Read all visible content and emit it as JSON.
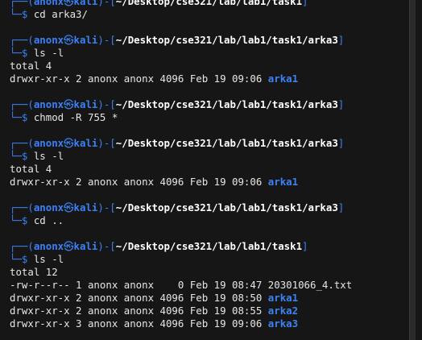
{
  "terminal": {
    "prompt": {
      "user": "anonx",
      "skull": "㉿",
      "host": "kali",
      "dollar": "$"
    },
    "colors": {
      "background": "#161616",
      "accent_blue": "#3b82f6",
      "text": "#e6e6e6",
      "path_text": "#ffffff"
    },
    "blocks": [
      {
        "prompt_path": "~/Desktop/cse321/lab/lab1/task1",
        "command": "cd arka3/"
      },
      {
        "prompt_path": "~/Desktop/cse321/lab/lab1/task1/arka3",
        "command": "ls -l",
        "output": [
          "total 4",
          {
            "perm": "drwxr-xr-x 2 anonx anonx 4096 Feb 19 09:06 ",
            "name": "arka1",
            "dir": true
          }
        ]
      },
      {
        "prompt_path": "~/Desktop/cse321/lab/lab1/task1/arka3",
        "command": "chmod -R 755 *"
      },
      {
        "prompt_path": "~/Desktop/cse321/lab/lab1/task1/arka3",
        "command": "ls -l",
        "output": [
          "total 4",
          {
            "perm": "drwxr-xr-x 2 anonx anonx 4096 Feb 19 09:06 ",
            "name": "arka1",
            "dir": true
          }
        ]
      },
      {
        "prompt_path": "~/Desktop/cse321/lab/lab1/task1/arka3",
        "command": "cd .."
      },
      {
        "prompt_path": "~/Desktop/cse321/lab/lab1/task1",
        "command": "ls -l",
        "output": [
          "total 12",
          {
            "perm": "-rw-r--r-- 1 anonx anonx    0 Feb 19 08:47 ",
            "name": "20301066_4.txt",
            "dir": false
          },
          {
            "perm": "drwxr-xr-x 2 anonx anonx 4096 Feb 19 08:50 ",
            "name": "arka1",
            "dir": true
          },
          {
            "perm": "drwxr-xr-x 2 anonx anonx 4096 Feb 19 08:55 ",
            "name": "arka2",
            "dir": true
          },
          {
            "perm": "drwxr-xr-x 3 anonx anonx 4096 Feb 19 09:06 ",
            "name": "arka3",
            "dir": true
          }
        ]
      }
    ]
  }
}
